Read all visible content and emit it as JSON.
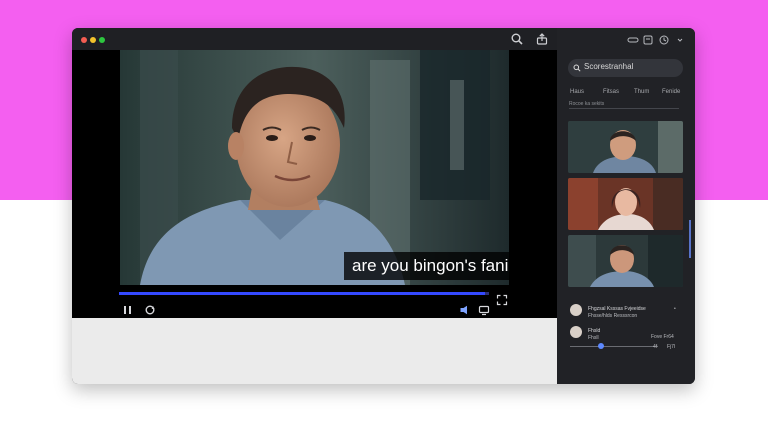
{
  "colors": {
    "background_top": "#f45ff0",
    "window": "#1a1b1f",
    "sidebar": "#212226",
    "progress_fill": "#3449ff",
    "scrollbar": "#5873c9"
  },
  "window": {
    "traffic_lights": [
      "#f45d52",
      "#f3c22c",
      "#2dc63f"
    ],
    "toolbar_icons": [
      "search-icon",
      "share-icon"
    ]
  },
  "player": {
    "caption": "are you bingon's fanice.",
    "progress": 0.99,
    "controls": {
      "left": [
        "play-icon",
        "loop-icon"
      ],
      "right": [
        "speaker-icon",
        "screen-icon",
        "fullscreen-icon"
      ]
    }
  },
  "sidebar": {
    "header_icons": [
      "dots-icon",
      "bookmark-icon",
      "clock-icon",
      "chevron-down-icon"
    ],
    "search_text": "Scorestranhal",
    "tabs": [
      "Haus",
      "Fitsas",
      "Thum",
      "Fenide"
    ],
    "tab_sublabel": "Rocoe ka sekits",
    "thumbnails": [
      {
        "icon": "video-thumbnail-icon",
        "subject": "man-smiling"
      },
      {
        "icon": "video-thumbnail-icon",
        "subject": "woman-smiling"
      },
      {
        "icon": "video-thumbnail-icon",
        "subject": "man-talking"
      }
    ],
    "comments": [
      {
        "name": "Fhgzsal Ksssas Fvjeeidse",
        "text": "Fhsse/hlds Resssrcon",
        "meta": "•"
      },
      {
        "name": "Fhsld",
        "text": "Fhsll",
        "meta": "Fove  Fr64"
      }
    ],
    "slider_value": 0.35,
    "slider_labels": [
      "4f",
      "Fj7I"
    ]
  }
}
